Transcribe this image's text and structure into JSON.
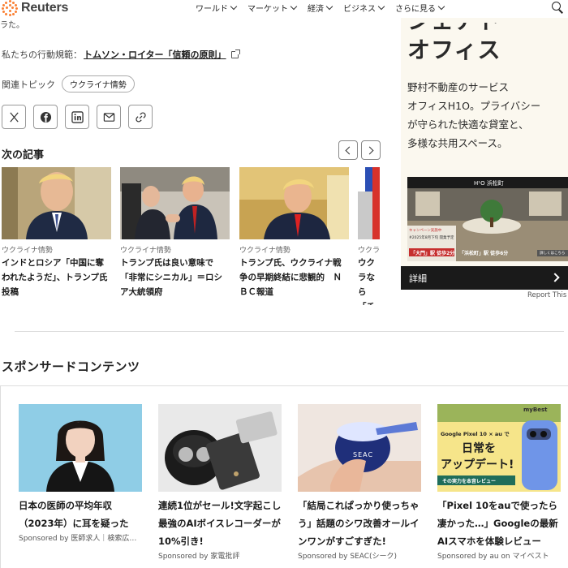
{
  "header": {
    "logo_text": "Reuters",
    "nav": [
      "ワールド",
      "マーケット",
      "経済",
      "ビジネス",
      "さらに見る"
    ]
  },
  "article": {
    "fragment": "ラた。",
    "principles_label": "私たちの行動規範：",
    "principles_link": "トムソン・ロイター「信頼の原則」",
    "topics_label": "関連トピック",
    "topic_chip": "ウクライナ情勢",
    "share_icons": [
      "x-icon",
      "facebook-icon",
      "linkedin-icon",
      "email-icon",
      "link-icon"
    ]
  },
  "next": {
    "title": "次の記事",
    "cards": [
      {
        "category": "ウクライナ情勢",
        "headline": "インドとロシア「中国に奪われたようだ」、トランプ氏投稿"
      },
      {
        "category": "ウクライナ情勢",
        "headline": "トランプ氏は良い意味で「非常にシニカル」＝ロシア大統領府"
      },
      {
        "category": "ウクライナ情勢",
        "headline": "トランプ氏、ウクライナ戦争の早期終結に悲観的　ＮＢＣ報道"
      },
      {
        "category": "ウクラ",
        "headline": "ウクラなら「チン氏"
      }
    ]
  },
  "ad": {
    "big_line1": "シェアド",
    "big_line2": "オフィス",
    "copy": [
      "野村不動産のサービス",
      "オフィスH1O。プライバシー",
      "が守られた快適な貸室と、",
      "多様な共用スペース。"
    ],
    "photo_brand": "H¹O 浜松町",
    "photo_campaign": "キャンペーン実施中",
    "photo_date": "#2025年8月下旬 開業予定",
    "photo_station1": "「大門」駅 徒歩2分",
    "photo_station2": "「浜松町」駅 徒歩6分",
    "photo_detail_btn": "詳しくはこちら",
    "cta": "詳細",
    "report": "Report This"
  },
  "sponsored": {
    "title": "スポンサードコンテンツ",
    "cards": [
      {
        "headline": "日本の医師の平均年収（2023年）に耳を疑った",
        "by": "Sponsored by 医師求人｜検索広…"
      },
      {
        "headline": "連続1位がセール!文字起こし最強のAIボイスレコーダーが10%引き!",
        "by": "Sponsored by 家電批評"
      },
      {
        "headline": "「結局これぱっかり使っちゃう」話題のシワ改善オールインワンがすごすぎた!",
        "by": "Sponsored by SEAC(シーク)"
      },
      {
        "headline": "「Pixel 10をauで使ったら凄かった…」Googleの最新AIスマホを体験レビュー",
        "by": "Sponsored by au on マイベスト"
      }
    ],
    "pixel_ad": {
      "brand": "myBest",
      "line1": "Google Pixel 10 × au で",
      "line2": "日常を",
      "line3": "アップデート!",
      "line4": "その実力を本音レビュー"
    },
    "seac_label": "SEAC"
  },
  "colors": {
    "logo_orange": "#fb8033",
    "ad_bg": "#fbf8ef",
    "cta_bg": "#1a1a1a"
  }
}
